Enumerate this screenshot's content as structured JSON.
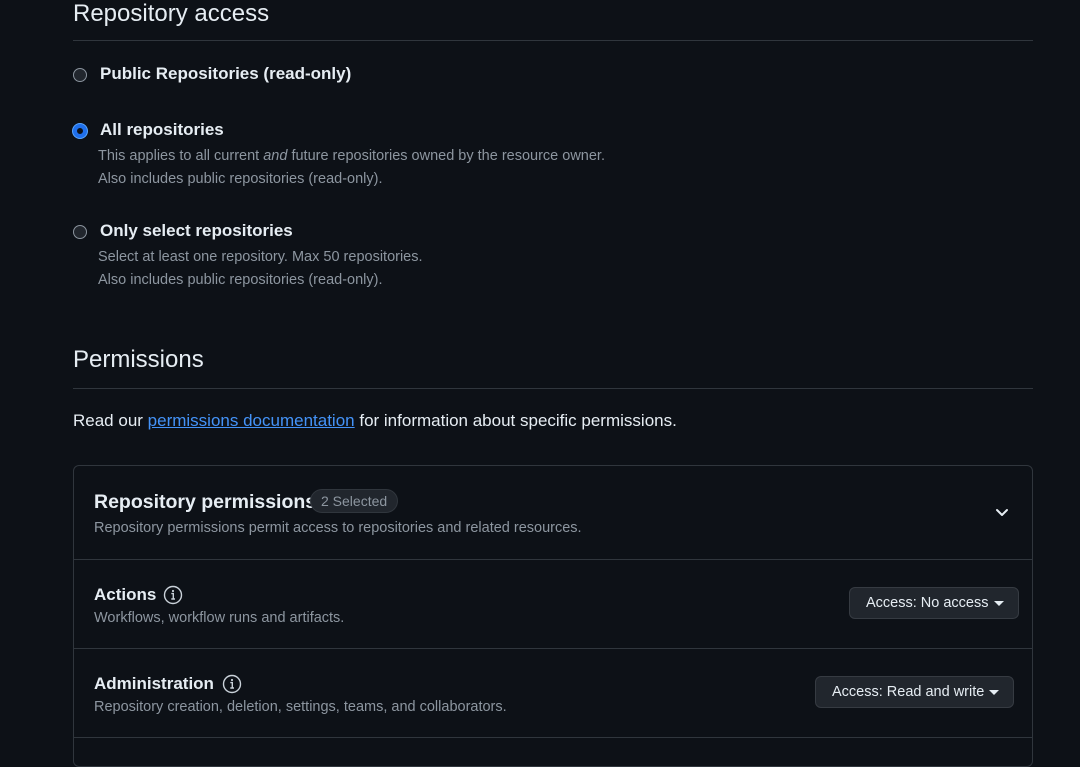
{
  "repository_access": {
    "title": "Repository access",
    "options": [
      {
        "label": "Public Repositories (read-only)",
        "selected": false,
        "notes": []
      },
      {
        "label": "All repositories",
        "selected": true,
        "notes": [
          "This applies to all current and future repositories owned by the resource owner.",
          "Also includes public repositories (read-only)."
        ]
      },
      {
        "label": "Only select repositories",
        "selected": false,
        "notes": [
          "Select at least one repository. Max 50 repositories.",
          "Also includes public repositories (read-only)."
        ]
      }
    ],
    "all_note_pre": "This applies to all current ",
    "all_note_em": "and",
    "all_note_post": " future repositories owned by the resource owner."
  },
  "permissions": {
    "title": "Permissions",
    "intro_pre": "Read our ",
    "intro_link": "permissions documentation",
    "intro_post": " for information about specific permissions.",
    "repository_permissions": {
      "title": "Repository permissions",
      "counter": "2 Selected",
      "description": "Repository permissions permit access to repositories and related resources.",
      "items": [
        {
          "name": "Actions",
          "description": "Workflows, workflow runs and artifacts.",
          "access": "Access: No access"
        },
        {
          "name": "Administration",
          "description": "Repository creation, deletion, settings, teams, and collaborators.",
          "access": "Access: Read and write"
        }
      ]
    }
  },
  "icons": {
    "info": "info-icon",
    "chevron": "chevron-down-icon",
    "caret": "caret-down-icon"
  },
  "colors": {
    "background": "#0d1117",
    "accent": "#1f6feb",
    "link": "#4493f8",
    "border": "#30363d",
    "muted_text": "#8d96a0"
  }
}
